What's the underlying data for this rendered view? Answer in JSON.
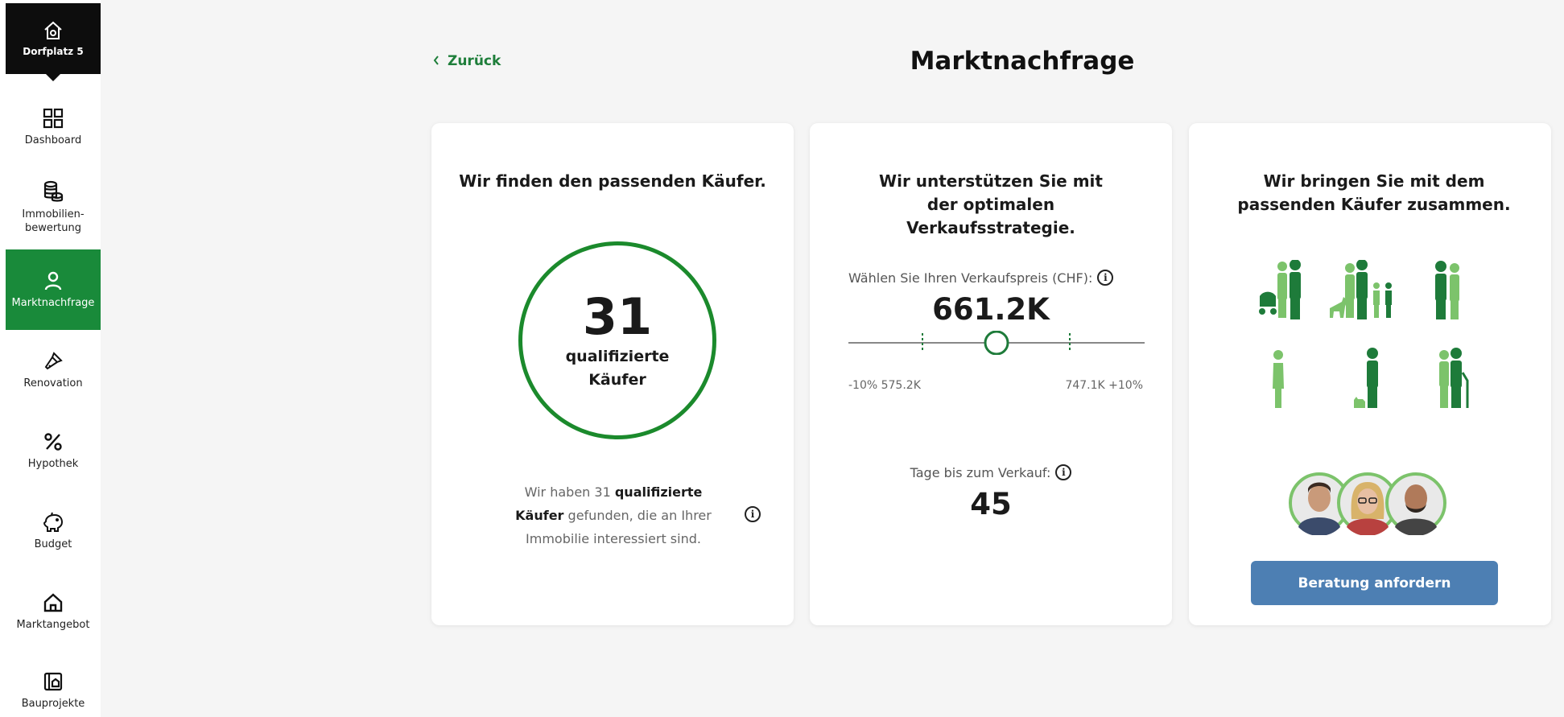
{
  "sidebar": {
    "property": {
      "label": "Dorfplatz 5",
      "icon": "house-settings-icon"
    },
    "items": [
      {
        "label": "Dashboard",
        "icon": "grid-icon"
      },
      {
        "label": "Immobilien-\nbewertung",
        "icon": "coins-icon"
      },
      {
        "label": "Marktnachfrage",
        "icon": "person-icon",
        "active": true
      },
      {
        "label": "Renovation",
        "icon": "paintbrush-icon"
      },
      {
        "label": "Hypothek",
        "icon": "percent-icon"
      },
      {
        "label": "Budget",
        "icon": "piggy-bank-icon"
      },
      {
        "label": "Marktangebot",
        "icon": "house-icon"
      },
      {
        "label": "Bauprojekte",
        "icon": "blueprint-icon"
      }
    ]
  },
  "header": {
    "back_label": "Zurück",
    "title": "Marktnachfrage"
  },
  "card1": {
    "heading": "Wir finden den passenden Käufer.",
    "count": "31",
    "count_label": "qualifizierte Käufer",
    "desc_prefix": "Wir haben 31 ",
    "desc_bold": "qualifizierte Käufer",
    "desc_suffix": " gefunden, die an Ihrer Immobilie interessiert sind."
  },
  "card2": {
    "heading": "Wir unterstützen Sie mit der optimalen Verkaufsstrategie.",
    "price_label": "Wählen Sie Ihren Verkaufspreis (CHF):",
    "price_value": "661.2K",
    "scale_left": "-10% 575.2K",
    "scale_right": "747.1K +10%",
    "slider_position": 0.5,
    "days_label": "Tage bis zum Verkauf:",
    "days_value": "45"
  },
  "card3": {
    "heading": "Wir bringen Sie mit dem passenden Käufer zusammen.",
    "cta_label": "Beratung anfordern"
  },
  "colors": {
    "accent_green": "#198a3a",
    "ring_green": "#1b8a2c",
    "light_green": "#7cc36b",
    "dark_green": "#1e7b3a",
    "button_blue": "#4d7fb3"
  }
}
